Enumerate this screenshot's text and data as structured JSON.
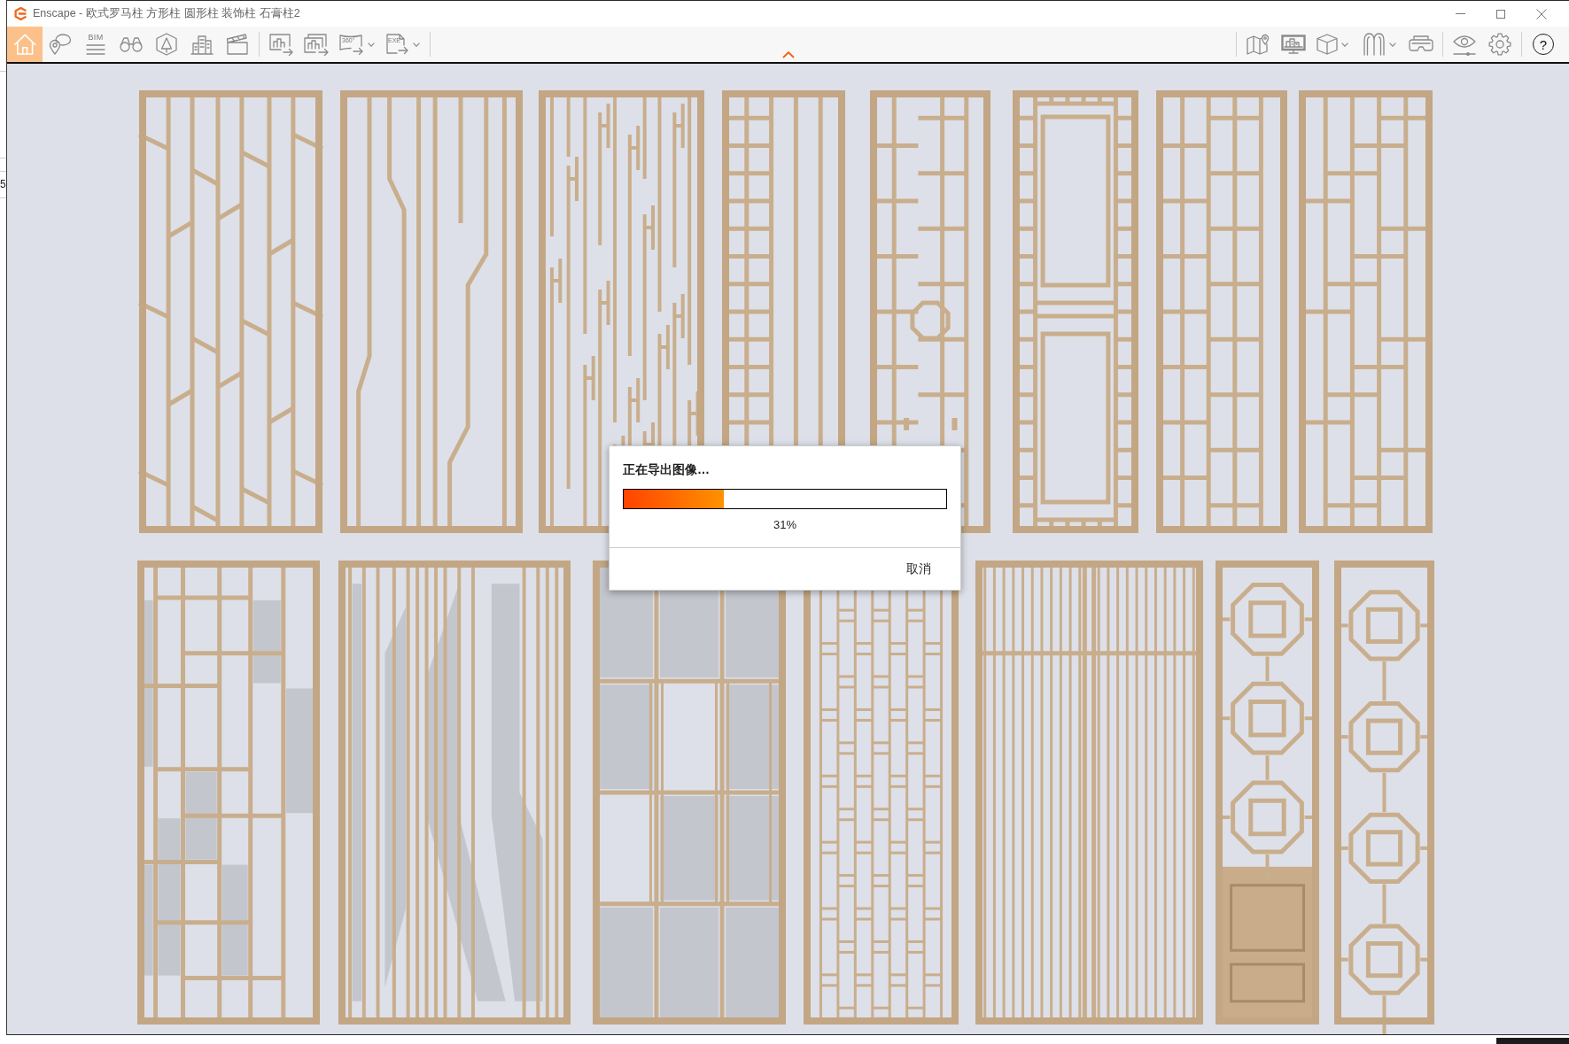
{
  "background_window": {
    "text": "5"
  },
  "window": {
    "title": "Enscape - 欧式罗马柱 方形柱 圆形柱 装饰柱 石膏柱2",
    "controls": [
      {
        "kind": "minimize"
      },
      {
        "kind": "maximize"
      },
      {
        "kind": "close"
      }
    ]
  },
  "toolbar": {
    "left_groups": [
      [
        {
          "kind": "home",
          "selected": true,
          "has_menu": false
        },
        {
          "kind": "pin-bubble",
          "selected": false,
          "has_menu": false
        },
        {
          "kind": "bim",
          "label": "BIM",
          "selected": false,
          "has_menu": false
        },
        {
          "kind": "binoculars",
          "selected": false,
          "has_menu": false
        },
        {
          "kind": "perspective",
          "selected": false,
          "has_menu": false
        },
        {
          "kind": "buildings",
          "selected": false,
          "has_menu": false
        },
        {
          "kind": "clapperboard",
          "selected": false,
          "has_menu": false
        }
      ],
      [
        {
          "kind": "image-export",
          "selected": false,
          "has_menu": false
        },
        {
          "kind": "batch-export",
          "selected": false,
          "has_menu": false
        },
        {
          "kind": "panorama-export",
          "label": "360°",
          "selected": false,
          "has_menu": true
        },
        {
          "kind": "exe-export",
          "label": "EXE",
          "selected": false,
          "has_menu": true
        }
      ]
    ],
    "right_groups": [
      [
        {
          "kind": "map",
          "selected": false,
          "has_menu": false
        },
        {
          "kind": "monitor",
          "selected": false,
          "has_menu": false
        },
        {
          "kind": "cube",
          "selected": false,
          "has_menu": true
        },
        {
          "kind": "arches",
          "selected": false,
          "has_menu": true
        },
        {
          "kind": "vr",
          "selected": false,
          "has_menu": false
        }
      ],
      [
        {
          "kind": "eye",
          "selected": false,
          "has_menu": false
        },
        {
          "kind": "gear",
          "selected": false,
          "has_menu": false
        }
      ],
      [
        {
          "kind": "help",
          "label": "?",
          "selected": false,
          "has_menu": false
        }
      ]
    ]
  },
  "dialog": {
    "title": "正在导出图像…",
    "progress": {
      "level": 0.31
    },
    "percent": "31%",
    "cancel": "取消"
  }
}
